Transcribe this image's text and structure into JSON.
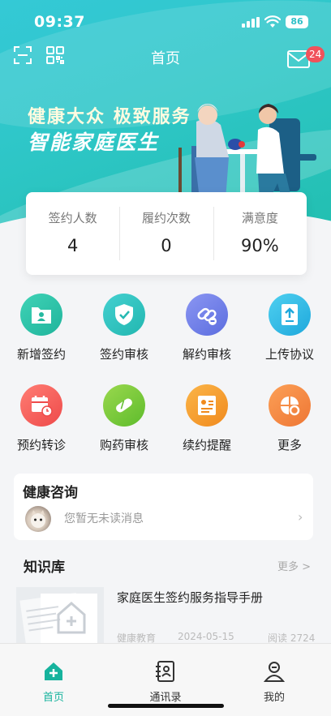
{
  "status_bar": {
    "time": "09:37",
    "battery": "86"
  },
  "header": {
    "title": "首页",
    "unread_count": "24"
  },
  "banner": {
    "slogan_line1": "健康大众  极致服务",
    "slogan_line2": "智能家庭医生"
  },
  "stats": [
    {
      "label": "签约人数",
      "value": "4"
    },
    {
      "label": "履约次数",
      "value": "0"
    },
    {
      "label": "满意度",
      "value": "90%"
    }
  ],
  "functions": [
    {
      "label": "新增签约",
      "icon": "folder-user-icon",
      "color": "#2cc0a8"
    },
    {
      "label": "签约审核",
      "icon": "shield-check-icon",
      "color": "#2bc2c0"
    },
    {
      "label": "解约审核",
      "icon": "link-minus-icon",
      "color": "#6f7ee8"
    },
    {
      "label": "上传协议",
      "icon": "document-upload-icon",
      "color": "#2ab8e6"
    },
    {
      "label": "预约转诊",
      "icon": "calendar-clock-icon",
      "color": "#f25a58"
    },
    {
      "label": "购药审核",
      "icon": "pill-icon",
      "color": "#7ccb3a"
    },
    {
      "label": "续约提醒",
      "icon": "contract-reminder-icon",
      "color": "#f39a2a"
    },
    {
      "label": "更多",
      "icon": "grid-more-icon",
      "color": "#f08a3a"
    }
  ],
  "consult": {
    "title": "健康咨询",
    "message": "您暂无未读消息"
  },
  "knowledge": {
    "title": "知识库",
    "more": "更多 >",
    "article": {
      "title": "家庭医生签约服务指导手册",
      "category": "健康教育",
      "date": "2024-05-15",
      "reads": "阅读 2724"
    }
  },
  "tabs": [
    {
      "label": "首页",
      "icon": "home-plus-icon",
      "active": true
    },
    {
      "label": "通讯录",
      "icon": "contacts-book-icon",
      "active": false
    },
    {
      "label": "我的",
      "icon": "profile-icon",
      "active": false
    }
  ]
}
